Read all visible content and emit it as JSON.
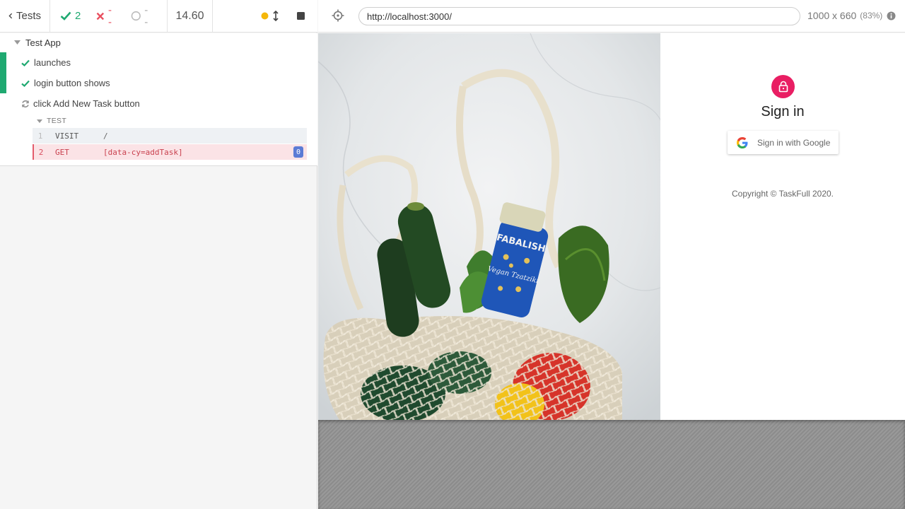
{
  "reporter": {
    "header": {
      "tests_label": "Tests",
      "passed": "2",
      "failed": "--",
      "pending": "--",
      "duration": "14.60"
    },
    "suite": {
      "title": "Test App",
      "tests": [
        {
          "title": "launches",
          "state": "passed"
        },
        {
          "title": "login button shows",
          "state": "passed"
        },
        {
          "title": "click Add New Task button",
          "state": "running"
        }
      ]
    },
    "commands": {
      "section_label": "TEST",
      "rows": [
        {
          "num": "1",
          "name": "VISIT",
          "message": "/"
        },
        {
          "num": "2",
          "name": "GET",
          "message": "[data-cy=addTask]",
          "count": "0"
        }
      ]
    }
  },
  "aut": {
    "url": "http://localhost:3000/",
    "viewport": "1000 x 660",
    "zoom": "(83%)",
    "signin": {
      "title": "Sign in",
      "google_button": "Sign in with Google",
      "copyright": "Copyright © TaskFull 2020."
    },
    "photo": {
      "jar_brand": "FABALISH",
      "jar_product": "Vegan Tzatziki"
    }
  },
  "colors": {
    "passed": "#1fa971",
    "failed": "#e94f5f",
    "running_dot": "#f5b70a",
    "accent_pink": "#e91e63",
    "badge_blue": "#5b7bd5"
  }
}
